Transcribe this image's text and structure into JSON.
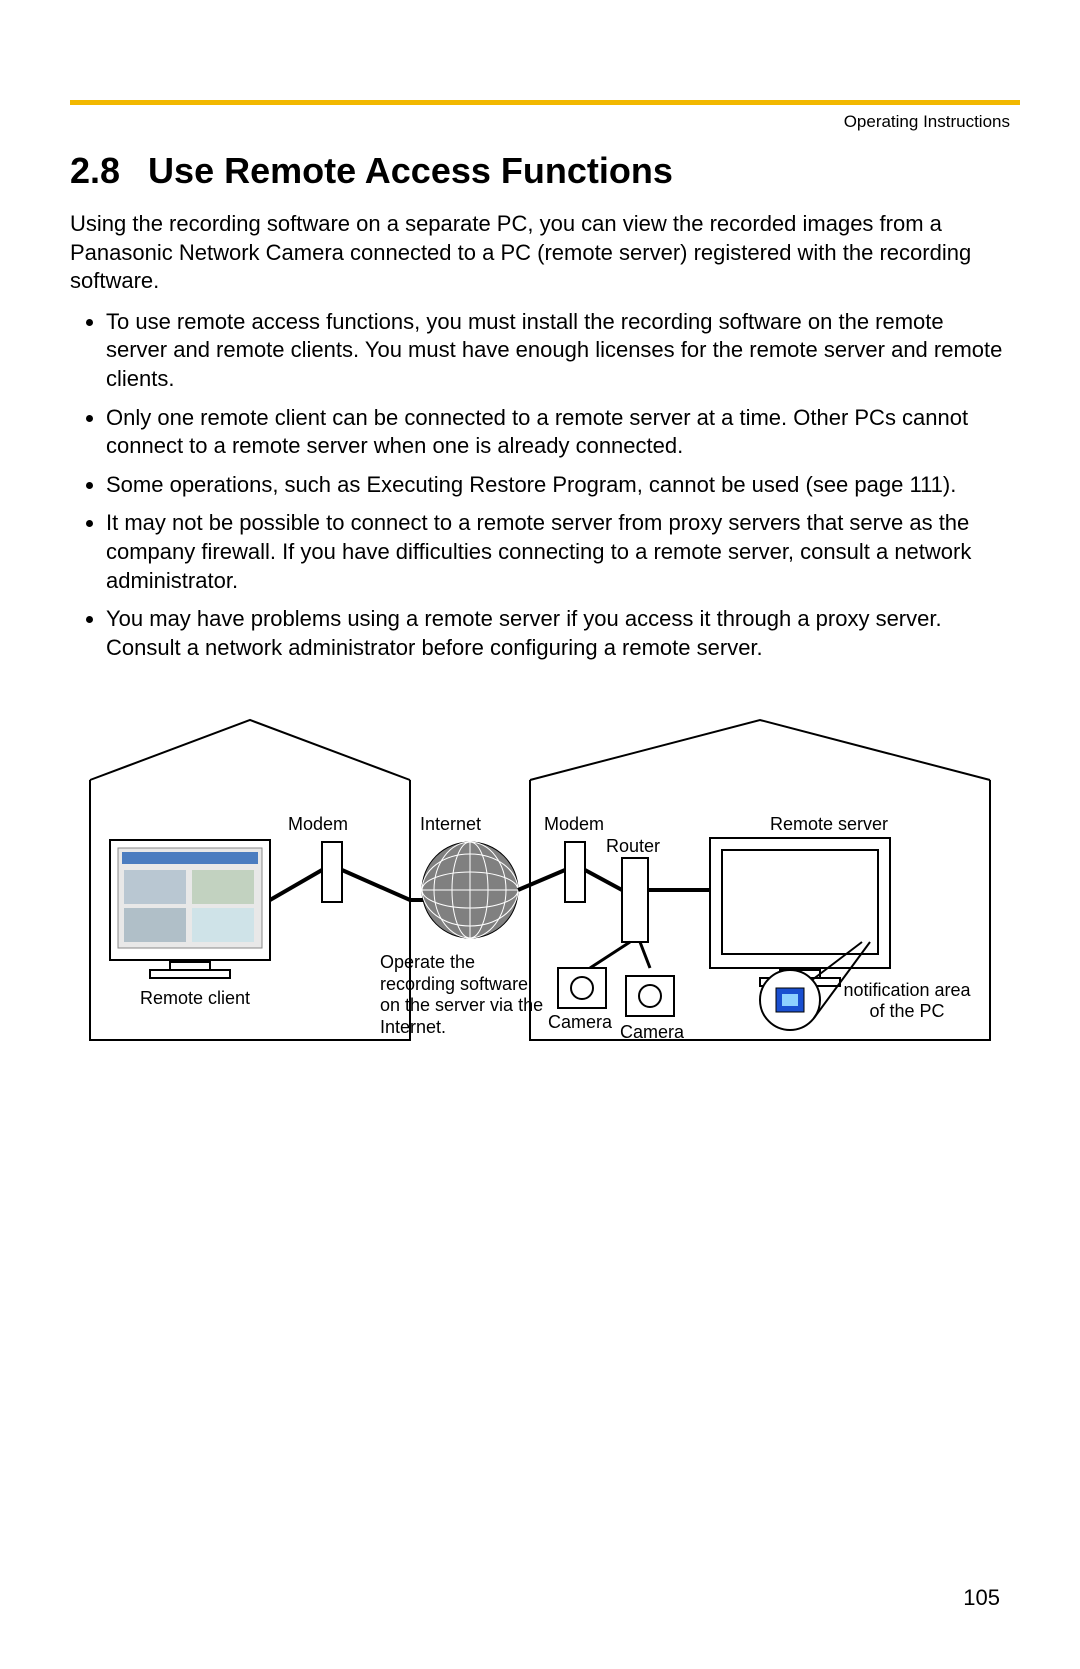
{
  "header": {
    "right": "Operating Instructions"
  },
  "section": {
    "number": "2.8",
    "title": "Use Remote Access Functions",
    "intro": "Using the recording software on a separate PC, you can view the recorded images from a Panasonic Network Camera connected to a PC (remote server) registered with the recording software.",
    "bullets": [
      "To use remote access functions, you must install the recording software on the remote server and remote clients. You must have enough licenses for the remote server and remote clients.",
      "Only one remote client can be connected to a remote server at a time. Other PCs cannot connect to a remote server when one is already connected.",
      "Some operations, such as Executing Restore Program, cannot be used (see page 111).",
      "It may not be possible to connect to a remote server from proxy servers that serve as the company firewall. If you have difficulties connecting to a remote server, consult a network administrator.",
      "You may have problems using a remote server if you access it through a proxy server. Consult a network administrator before configuring a remote server."
    ]
  },
  "diagram": {
    "labels": {
      "remote_client": "Remote client",
      "modem_left": "Modem",
      "internet": "Internet",
      "operate_note": "Operate the recording software on the server via the Internet.",
      "modem_right": "Modem",
      "router": "Router",
      "camera1": "Camera",
      "camera2": "Camera",
      "remote_server": "Remote server",
      "notif": "notification area of the PC"
    }
  },
  "page_number": "105"
}
